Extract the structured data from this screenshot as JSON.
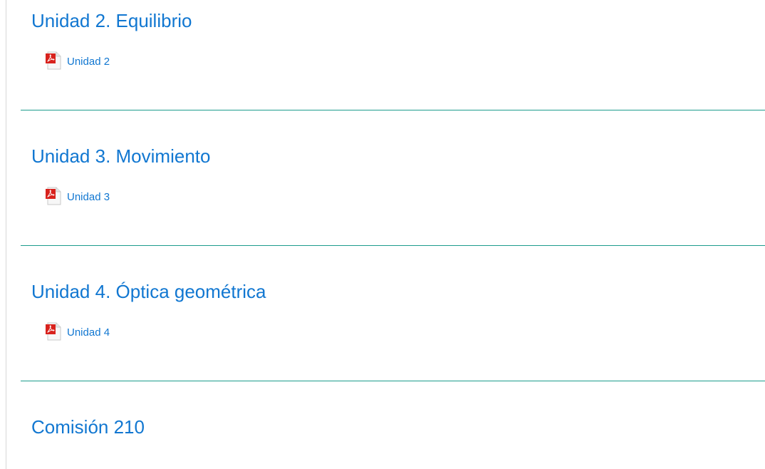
{
  "sections": [
    {
      "title": "Unidad 2. Equilibrio",
      "activity": {
        "label": "Unidad 2",
        "icon": "pdf-icon"
      }
    },
    {
      "title": "Unidad 3. Movimiento",
      "activity": {
        "label": "Unidad 3",
        "icon": "pdf-icon"
      }
    },
    {
      "title": "Unidad 4. Óptica geométrica",
      "activity": {
        "label": "Unidad 4",
        "icon": "pdf-icon"
      }
    },
    {
      "title": "Comisión 210"
    }
  ],
  "colors": {
    "link": "#1177d1",
    "divider": "#1d9c8c",
    "pdf_red": "#d8221d"
  }
}
